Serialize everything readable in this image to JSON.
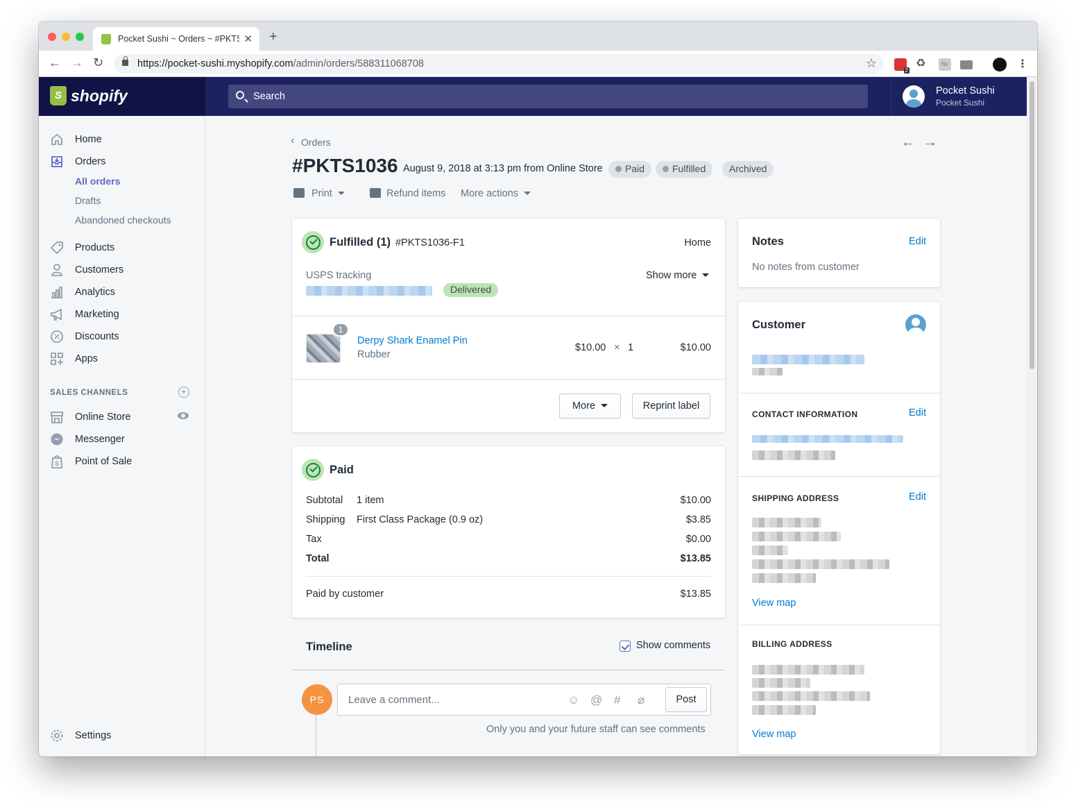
{
  "browser": {
    "tab_title": "Pocket Sushi ~ Orders ~ #PKTS",
    "url_host": "https://pocket-sushi.myshopify.com",
    "url_path": "/admin/orders/588311068708",
    "ext_badge": "2",
    "ext_nx": "Nx"
  },
  "header": {
    "logo": "shopify",
    "search_placeholder": "Search",
    "account_name": "Pocket Sushi",
    "account_store": "Pocket Sushi"
  },
  "sidebar": {
    "items": [
      {
        "label": "Home",
        "icon": "home-icon"
      },
      {
        "label": "Orders",
        "icon": "orders-icon"
      },
      {
        "label": "Products",
        "icon": "tag-icon"
      },
      {
        "label": "Customers",
        "icon": "person-icon"
      },
      {
        "label": "Analytics",
        "icon": "bar-chart-icon"
      },
      {
        "label": "Marketing",
        "icon": "megaphone-icon"
      },
      {
        "label": "Discounts",
        "icon": "discount-icon"
      },
      {
        "label": "Apps",
        "icon": "apps-icon"
      }
    ],
    "orders_sub": [
      "All orders",
      "Drafts",
      "Abandoned checkouts"
    ],
    "sales_channels_heading": "SALES CHANNELS",
    "channels": [
      {
        "label": "Online Store",
        "icon": "store-icon"
      },
      {
        "label": "Messenger",
        "icon": "messenger-icon"
      },
      {
        "label": "Point of Sale",
        "icon": "pos-bag-icon"
      }
    ],
    "settings": "Settings"
  },
  "order": {
    "breadcrumb": "Orders",
    "number": "#PKTS1036",
    "meta": "August 9, 2018 at 3:13 pm from Online Store",
    "badges": [
      "Paid",
      "Fulfilled",
      "Archived"
    ],
    "actions": {
      "print": "Print",
      "refund": "Refund items",
      "more": "More actions"
    }
  },
  "fulfilled": {
    "title": "Fulfilled (1)",
    "code": "#PKTS1036-F1",
    "location": "Home",
    "tracking_label": "USPS tracking",
    "show_more": "Show more",
    "status": "Delivered",
    "item": {
      "qty_badge": "1",
      "name": "Derpy Shark Enamel Pin",
      "variant": "Rubber",
      "price": "$10.00",
      "times": "×",
      "qty": "1",
      "total": "$10.00"
    },
    "more_button": "More",
    "reprint_button": "Reprint label"
  },
  "paid": {
    "title": "Paid",
    "rows": [
      {
        "label": "Subtotal",
        "detail": "1 item",
        "amount": "$10.00"
      },
      {
        "label": "Shipping",
        "detail": "First Class Package (0.9 oz)",
        "amount": "$3.85"
      },
      {
        "label": "Tax",
        "detail": "",
        "amount": "$0.00"
      },
      {
        "label": "Total",
        "detail": "",
        "amount": "$13.85"
      }
    ],
    "paid_by_label": "Paid by customer",
    "paid_by_amount": "$13.85"
  },
  "timeline": {
    "title": "Timeline",
    "show_comments": "Show comments",
    "avatar_initials": "PS",
    "comment_placeholder": "Leave a comment...",
    "post_button": "Post",
    "hint": "Only you and your future staff can see comments"
  },
  "notes": {
    "title": "Notes",
    "edit": "Edit",
    "text": "No notes from customer"
  },
  "customer": {
    "title": "Customer",
    "contact_heading": "CONTACT INFORMATION",
    "shipping_heading": "SHIPPING ADDRESS",
    "billing_heading": "BILLING ADDRESS",
    "edit": "Edit",
    "view_map": "View map"
  }
}
